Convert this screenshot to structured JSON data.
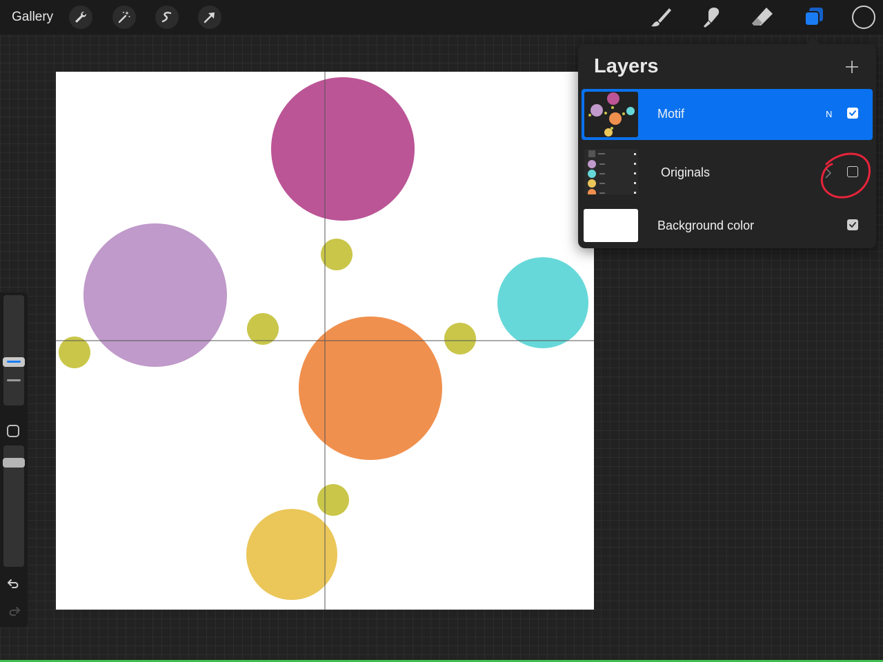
{
  "topbar": {
    "gallery_label": "Gallery",
    "left_tools": [
      "wrench-icon",
      "magic-wand-icon",
      "selection-icon",
      "transform-arrow-icon"
    ],
    "right_tools": [
      "brush-icon",
      "smudge-icon",
      "eraser-icon",
      "layers-icon"
    ],
    "layers_icon_color": "#1a7cf5",
    "current_color": "#1b1b1b"
  },
  "sidebar": {
    "brush_size_slider_color": "#1a7cf5",
    "opacity_slider_color": "#b5b5b5",
    "undo_icon": "undo-icon",
    "redo_icon": "redo-icon"
  },
  "canvas": {
    "background": "#ffffff",
    "circles": [
      {
        "name": "magenta-circle",
        "color": "#bb5596"
      },
      {
        "name": "lilac-circle",
        "color": "#c09aca"
      },
      {
        "name": "cyan-circle",
        "color": "#67d8d9"
      },
      {
        "name": "orange-circle",
        "color": "#f0904e"
      },
      {
        "name": "yellow-circle",
        "color": "#ebc659"
      },
      {
        "name": "olive-dot",
        "color": "#c9c64a"
      }
    ]
  },
  "layers": {
    "title": "Layers",
    "add_icon": "plus-icon",
    "items": [
      {
        "name": "Motif",
        "blend_mode": "N",
        "visible": true,
        "selected": true
      },
      {
        "name": "Originals",
        "visible": false,
        "group": true
      },
      {
        "name": "Background color",
        "visible": true
      }
    ]
  },
  "annotation_color": "#e8233a"
}
